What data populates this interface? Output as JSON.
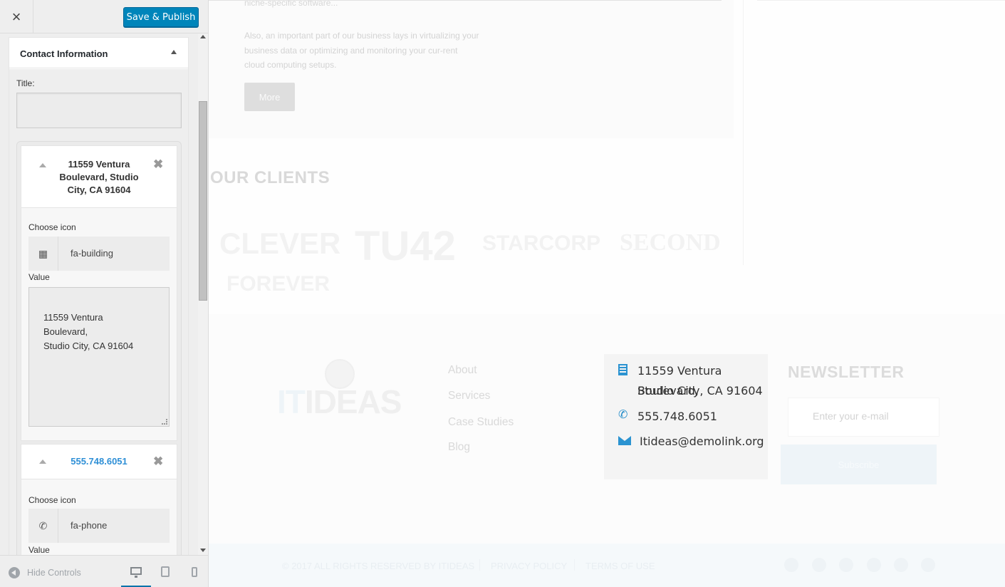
{
  "sidebar": {
    "close_glyph": "×",
    "publish_label": "Save & Publish",
    "widget": {
      "title": "Contact Information",
      "title_field_label": "Title:",
      "title_field_value": "",
      "items": [
        {
          "heading": "11559 Ventura Boulevard, Studio City, CA 91604",
          "heading_color": "#32373c",
          "choose_icon_label": "Choose icon",
          "icon_name": "fa-building",
          "value_label": "Value",
          "value": "11559 Ventura\nBoulevard,\nStudio City, CA 91604"
        },
        {
          "heading": "555.748.6051",
          "heading_color": "#2e8fd6",
          "choose_icon_label": "Choose icon",
          "icon_name": "fa-phone",
          "value_label": "Value"
        }
      ]
    },
    "footer": {
      "hide_controls_label": "Hide Controls",
      "active_device": "desktop"
    }
  },
  "preview": {
    "services": {
      "text_top": "niche-specific software...",
      "text_body": "Also, an important part of our business lays in virtualizing your business data or optimizing and monitoring your cur-rent cloud computing setups.",
      "more_label": "More"
    },
    "clients": {
      "heading": "OUR CLIENTS",
      "logos": [
        "CLEVER",
        "TU42",
        "STARCORP",
        "SECOND",
        "FOREVER"
      ]
    },
    "footer": {
      "brand_it": "IT",
      "brand_rest": "IDEAS",
      "nav": [
        "About",
        "Services",
        "Case Studies",
        "Blog"
      ],
      "contact": {
        "address_line1": "11559 Ventura Boulevard,",
        "address_line2": "Studio City, CA 91604",
        "phone": "555.748.6051",
        "email": "Itideas@demolink.org",
        "icon_color": "#2b93d1"
      },
      "newsletter": {
        "heading": "NEWSLETTER",
        "placeholder": "Enter your e-mail",
        "button_label": "Subscribe"
      },
      "bottom": {
        "copyright": "© 2017 ALL RIGHTS RESERVED BY ITIDEAS",
        "privacy": "PRIVACY POLICY",
        "terms": "TERMS OF USE",
        "social_icons": [
          "facebook-icon",
          "twitter-icon",
          "google-plus-icon",
          "vine-icon",
          "youtube-icon",
          "dribbble-icon"
        ]
      }
    }
  }
}
